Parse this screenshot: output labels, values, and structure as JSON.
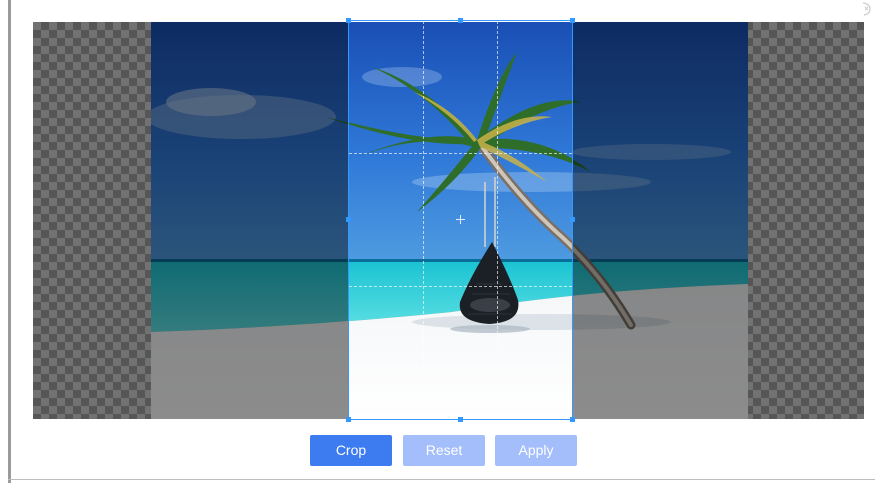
{
  "buttons": {
    "crop_label": "Crop",
    "reset_label": "Reset",
    "apply_label": "Apply"
  },
  "icons": {
    "corner": "close-icon",
    "center": "crosshair-icon"
  },
  "colors": {
    "primary": "#3d7bf0",
    "disabled": "#a3befa",
    "crop_border": "#3399ff"
  }
}
